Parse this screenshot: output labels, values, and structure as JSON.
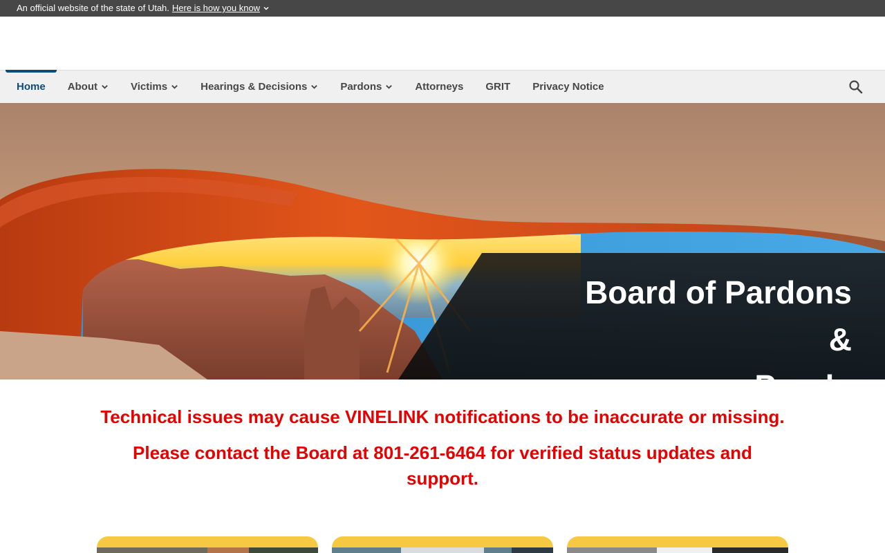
{
  "gov_banner": {
    "text": "An official website of the state of Utah.",
    "link": "Here is how you know"
  },
  "nav": {
    "items": [
      {
        "label": "Home",
        "active": true,
        "dropdown": false
      },
      {
        "label": "About",
        "active": false,
        "dropdown": true
      },
      {
        "label": "Victims",
        "active": false,
        "dropdown": true
      },
      {
        "label": "Hearings & Decisions",
        "active": false,
        "dropdown": true
      },
      {
        "label": "Pardons",
        "active": false,
        "dropdown": true
      },
      {
        "label": "Attorneys",
        "active": false,
        "dropdown": false
      },
      {
        "label": "GRIT",
        "active": false,
        "dropdown": false
      },
      {
        "label": "Privacy Notice",
        "active": false,
        "dropdown": false
      }
    ],
    "search_icon": "search-icon"
  },
  "hero": {
    "title_line1": "Board of Pardons &",
    "title_line2": "Parole"
  },
  "notice": {
    "line1": "Technical issues may cause VINELINK notifications to be inaccurate or missing.",
    "line2": "Please contact the Board at 801-261-6464 for verified status updates and support."
  },
  "colors": {
    "banner_bg": "#474747",
    "nav_bg": "#f0f0f0",
    "nav_active": "#0b4b7d",
    "notice_red": "#e60000",
    "card_accent": "#f7c942"
  }
}
